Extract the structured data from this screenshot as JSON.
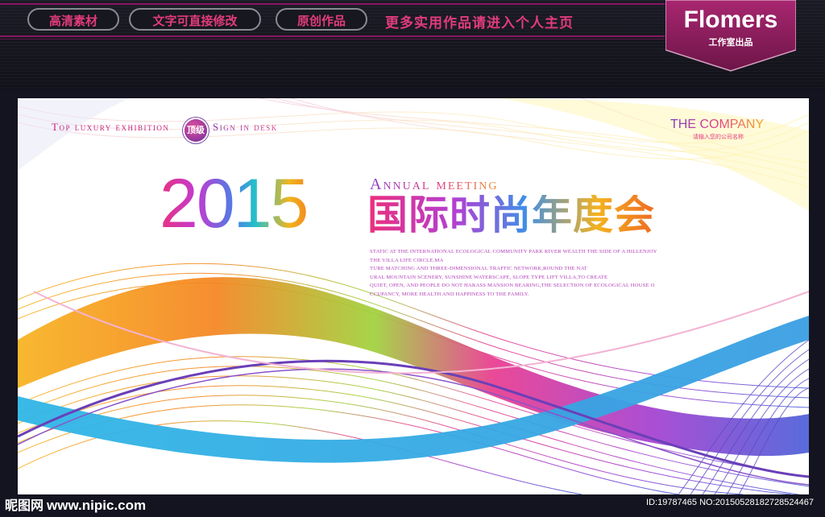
{
  "header": {
    "pills": [
      "高清素材",
      "文字可直接修改",
      "原创作品"
    ],
    "promo": "更多实用作品请进入个人主页",
    "brand_name": "Flomers",
    "brand_sub": "工作室出品",
    "colors": {
      "accent": "#e23b7d",
      "brand_bg": "#8a1a5c",
      "background": "#141420"
    }
  },
  "board": {
    "tagline_left": "Top luxury exhibition",
    "badge": "顶级",
    "tagline_right": "Sign in desk",
    "company": "THE COMPANY",
    "company_sub": "请输入您的公司名称",
    "year": "2015",
    "annual": "Annual meeting",
    "title_cn": "国际时尚年度会",
    "paragraph": [
      "STATIC AT THE INTERNATIONAL ECOLOGICAL COMMUNITY PARK RIVER WEALTH THE SIDE OF A HILLENJOY",
      "THE VILLA LIFE CIRCLE.MA",
      "TURE MATCHING AND THREE-DIMENSIONAL TRAFFIC NETWORK,ROUND THE NAT",
      "URAL MOUNTAIN SCENERY, SUNSHINE WATERSCAPE, SLOPE TYPE LIFT VILLA,TO CREATE",
      "QUIET, OPEN, AND PEOPLE DO NOT HARASS MANSION BEARING,THE SELECTION OF ECOLOGICAL HOUSE O",
      "CCUPANCY, MORE HEALTH AND HAPPINESS TO THE FAMILY."
    ]
  },
  "footer": {
    "site_cn": "昵图网",
    "site_url": "www.nipic.com",
    "id_text": "ID:19787465 NO:20150528182728524467"
  }
}
